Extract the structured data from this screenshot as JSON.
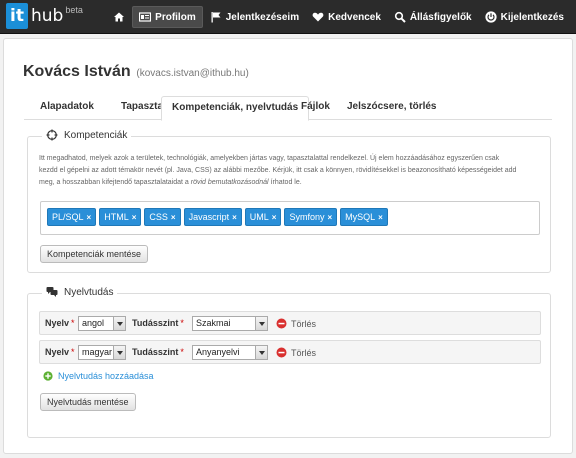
{
  "brand": {
    "it": "it",
    "hub": "hub",
    "beta": "beta"
  },
  "nav": [
    {
      "label": "",
      "icon": "home-icon"
    },
    {
      "label": "Profilom",
      "icon": "profile-card-icon",
      "active": true
    },
    {
      "label": "Jelentkezéseim",
      "icon": "flag-icon"
    },
    {
      "label": "Kedvencek",
      "icon": "heart-icon"
    },
    {
      "label": "Állásfigyelők",
      "icon": "search-icon"
    },
    {
      "label": "Kijelentkezés",
      "icon": "power-icon"
    }
  ],
  "user": {
    "name": "Kovács István",
    "email": "(kovacs.istvan@ithub.hu)"
  },
  "tabs": [
    {
      "label": "Alapadatok"
    },
    {
      "label": "Tapasztalat"
    },
    {
      "label": "Kompetenciák, nyelvtudás",
      "active": true
    },
    {
      "label": "Fájlok"
    },
    {
      "label": "Jelszócsere, törlés"
    }
  ],
  "competencies": {
    "legend": "Kompetenciák",
    "help_1": "Itt megadhatod, melyek azok a területek, technológiák, amelyekben jártas vagy, tapasztalattal rendelkezel. Új elem hozzáadásához egyszerűen csak",
    "help_2": "kezdd el gépelni az adott témakör nevét (pl. Java, CSS) az alábbi mezőbe. Kérjük, itt csak a könnyen, rövidítésekkel is beazonosítható képességeidet add",
    "help_3a": "meg, a hosszabban kifejtendő tapasztalataidat a ",
    "help_3b": "rövid bemutatkozásodnál",
    "help_3c": " írhatod le.",
    "tags": [
      "PL/SQL",
      "HTML",
      "CSS",
      "Javascript",
      "UML",
      "Symfony",
      "MySQL"
    ],
    "remove_glyph": "×",
    "save_label": "Kompetenciák mentése"
  },
  "languages": {
    "legend": "Nyelvtudás",
    "lang_label": "Nyelv",
    "level_label": "Tudásszint",
    "required_mark": "*",
    "rows": [
      {
        "language": "angol",
        "level": "Szakmai"
      },
      {
        "language": "magyar",
        "level": "Anyanyelvi"
      }
    ],
    "delete_label": "Törlés",
    "add_label": "Nyelvtudás hozzáadása",
    "save_label": "Nyelvtudás mentése"
  },
  "colors": {
    "accent": "#2a8fd8",
    "navbar": "#2b2b2b",
    "delete": "#d9302f",
    "add": "#5cb032"
  }
}
